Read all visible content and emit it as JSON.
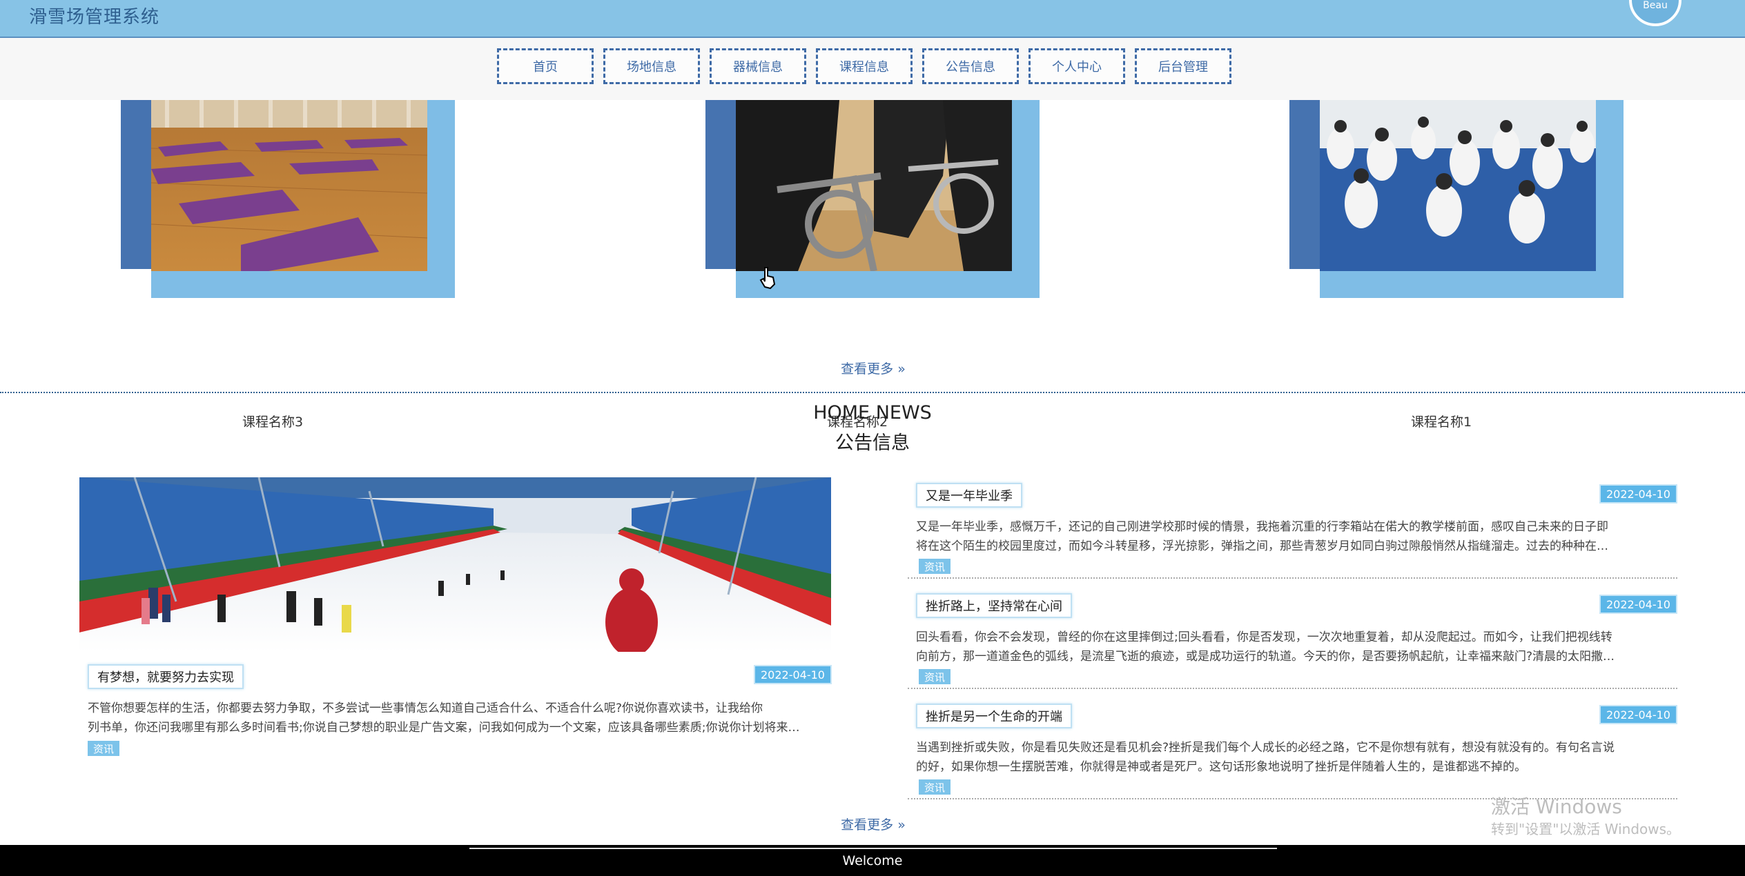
{
  "header": {
    "title": "滑雪场管理系统",
    "avatar_text": "Beau"
  },
  "nav": {
    "items": [
      "首页",
      "场地信息",
      "器械信息",
      "课程信息",
      "公告信息",
      "个人中心",
      "后台管理"
    ]
  },
  "courses": {
    "items": [
      {
        "name": "课程名称3"
      },
      {
        "name": "课程名称2"
      },
      {
        "name": "课程名称1"
      }
    ],
    "more": "查看更多"
  },
  "news": {
    "title_en": "HOME NEWS",
    "title_cn": "公告信息",
    "featured": {
      "title": "有梦想，就要努力去实现",
      "date": "2022-04-10",
      "line1": "不管你想要怎样的生活，你都要去努力争取，不多尝试一些事情怎么知道自己适合什么、不适合什么呢?你说你喜欢读书，让我给你",
      "line2": "列书单，你还问我哪里有那么多时间看书;你说自己梦想的职业是广告文案，问我如何成为一个文案，应该具备哪些素质;你说你计划将来…",
      "tag": "资讯"
    },
    "list": [
      {
        "title": "又是一年毕业季",
        "date": "2022-04-10",
        "line1": "又是一年毕业季，感慨万千，还记的自己刚进学校那时候的情景，我拖着沉重的行李箱站在偌大的教学楼前面，感叹自己未来的日子即",
        "line2": "将在这个陌生的校园里度过，而如今斗转星移，浮光掠影，弹指之间，那些青葱岁月如同白驹过隙般悄然从指缝溜走。过去的种种在…",
        "tag": "资讯"
      },
      {
        "title": "挫折路上，坚持常在心间",
        "date": "2022-04-10",
        "line1": "回头看看，你会不会发现，曾经的你在这里摔倒过;回头看看，你是否发现，一次次地重复着，却从没爬起过。而如今，让我们把视线转",
        "line2": "向前方，那一道道金色的弧线，是流星飞逝的痕迹，或是成功运行的轨道。今天的你，是否要扬帆起航，让幸福来敲门?清晨的太阳撒…",
        "tag": "资讯"
      },
      {
        "title": "挫折是另一个生命的开端",
        "date": "2022-04-10",
        "line1": "当遇到挫折或失败，你是看见失败还是看见机会?挫折是我们每个人成长的必经之路，它不是你想有就有，想没有就没有的。有句名言说",
        "line2": "的好，如果你想一生摆脱苦难，你就得是神或者是死尸。这句话形象地说明了挫折是伴随着人生的，是谁都逃不掉的。",
        "tag": "资讯"
      }
    ],
    "more": "查看更多"
  },
  "watermark": {
    "line1": "激活 Windows",
    "line2": "转到\"设置\"以激活 Windows。"
  },
  "footer": {
    "text": "Welcome"
  },
  "colors": {
    "header_bg": "#87c3e6",
    "nav_border": "#3e6aa6",
    "card_dark": "#4673b0",
    "card_light": "#7fbde6",
    "date_badge": "#5bb6e8"
  }
}
